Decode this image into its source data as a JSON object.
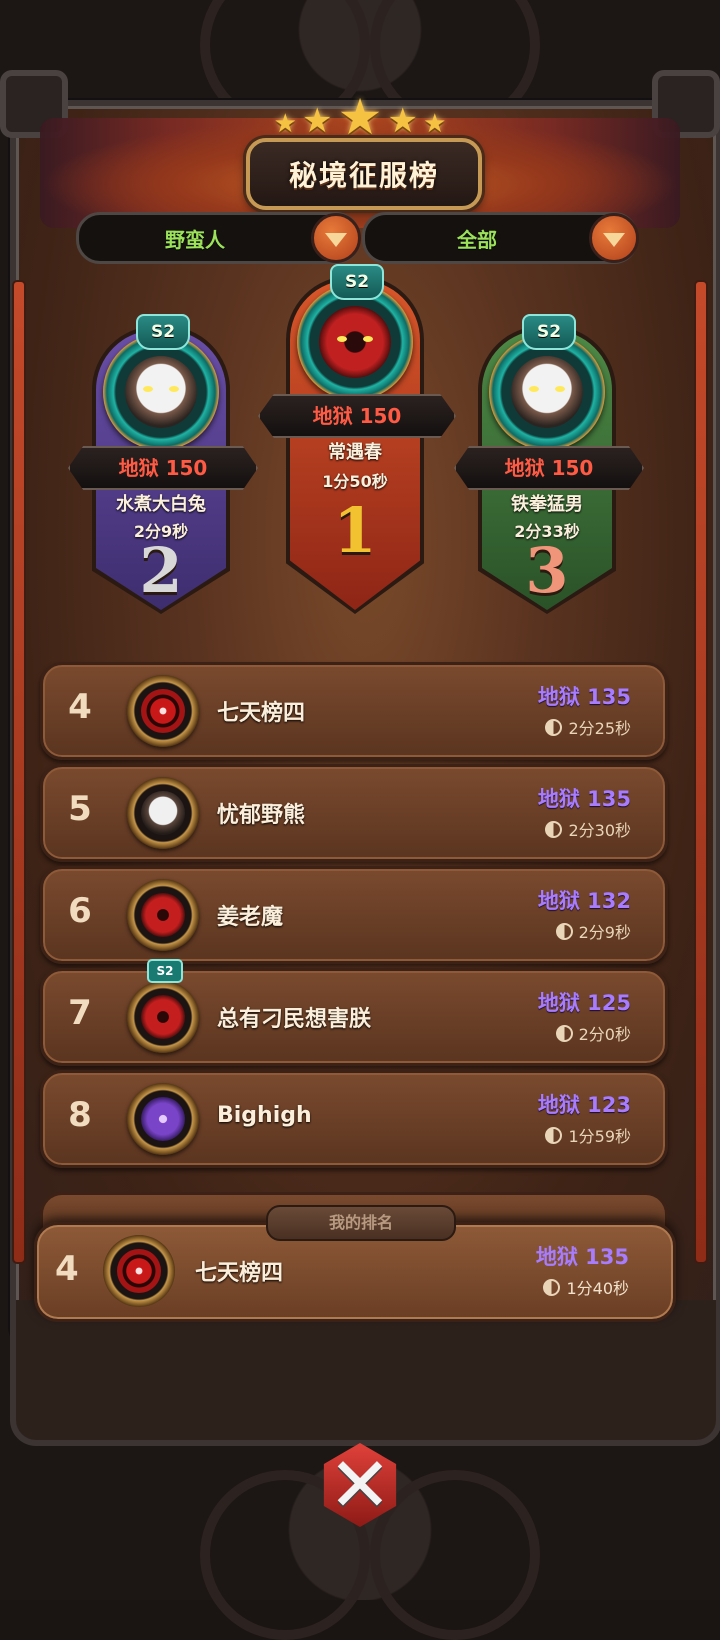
{
  "title": "秘境征服榜",
  "filters": {
    "class_selected": "野蛮人",
    "scope_selected": "全部"
  },
  "podium": [
    {
      "rank": "1",
      "season": "S2",
      "score": "地狱 150",
      "name": "常遇春",
      "time": "1分50秒",
      "avatar": "demon-avatar"
    },
    {
      "rank": "2",
      "season": "S2",
      "score": "地狱 150",
      "name": "水煮大白兔",
      "time": "2分9秒",
      "avatar": "sheep-avatar"
    },
    {
      "rank": "3",
      "season": "S2",
      "score": "地狱 150",
      "name": "铁拳猛男",
      "time": "2分33秒",
      "avatar": "sheep-avatar"
    }
  ],
  "list": [
    {
      "rank": "4",
      "name": "七天榜四",
      "score": "地狱 135",
      "time": "2分25秒",
      "avatar": "target-avatar"
    },
    {
      "rank": "5",
      "name": "忧郁野熊",
      "score": "地狱 135",
      "time": "2分30秒",
      "avatar": "sheep-avatar"
    },
    {
      "rank": "6",
      "name": "姜老魔",
      "score": "地狱 132",
      "time": "2分9秒",
      "avatar": "demon-avatar"
    },
    {
      "rank": "7",
      "name": "总有刁民想害朕",
      "score": "地狱 125",
      "time": "2分0秒",
      "avatar": "demon-avatar",
      "season": "S2"
    },
    {
      "rank": "8",
      "name": "Bighigh",
      "score": "地狱 123",
      "time": "1分59秒",
      "avatar": "wizard-avatar"
    }
  ],
  "my_rank": {
    "tag": "我的排名",
    "rank": "4",
    "name": "七天榜四",
    "score": "地狱 135",
    "time": "1分40秒"
  },
  "colors": {
    "score_purple": "#a77cff",
    "podium_score_red": "#ff5a44",
    "filter_green": "#9be25a",
    "rank1_gold": "#f2c230",
    "rank2_silver": "#d8d8d8",
    "rank3_salmon": "#f0957a"
  },
  "icons": [
    "star-icon",
    "dropdown-arrow-icon",
    "clock-icon",
    "close-icon"
  ]
}
